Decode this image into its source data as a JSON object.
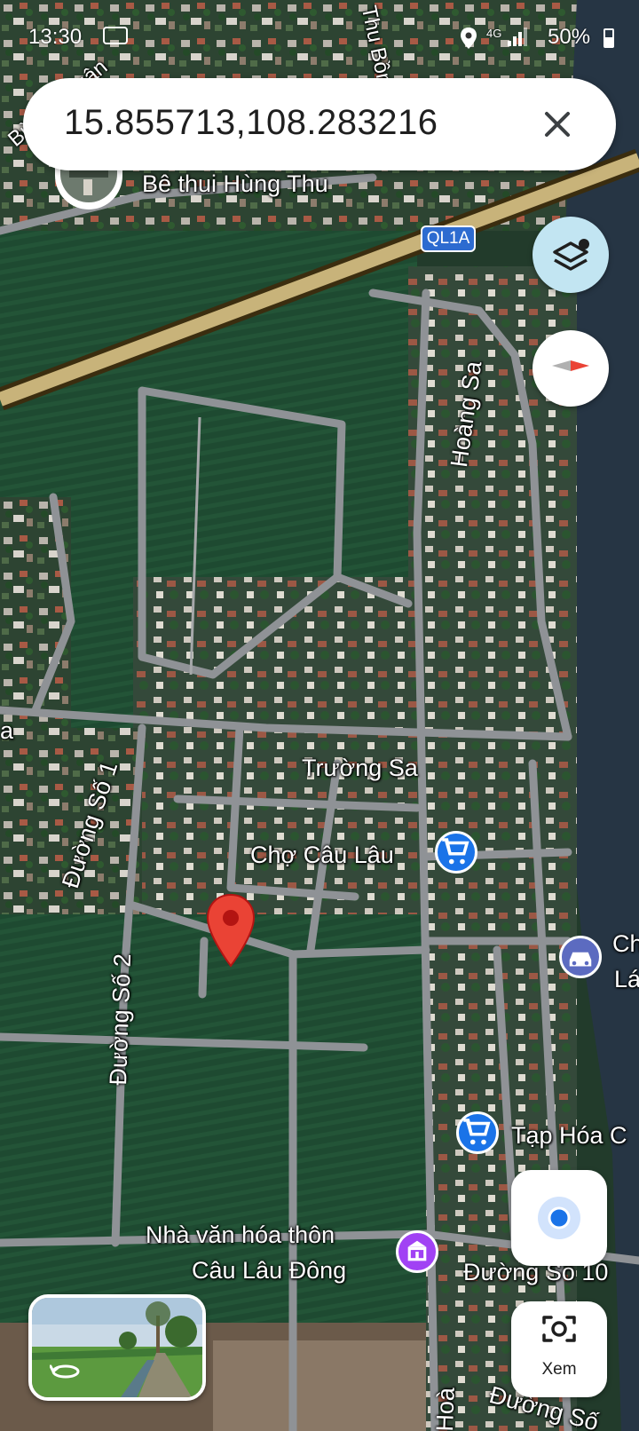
{
  "status_bar": {
    "time": "13:30",
    "battery": "50%",
    "network": "4G"
  },
  "search": {
    "query": "15.855713,108.283216",
    "close_icon": "close-icon"
  },
  "map": {
    "road_badge": "QL1A",
    "labels": {
      "street_bui_thi_xuan": "Bùi Thị Xuân",
      "street_thu_bon": "Thu Bồn",
      "poi_be_thui": "Bê thui Hùng Thu",
      "street_hoang_sa": "Hoàng Sa",
      "street_truong_sa": "Trường Sa",
      "street_duong_so_1": "Đường Số 1",
      "poi_cho_cau_lau": "Chợ Câu Lâu",
      "street_duong_so_2": "Đường Số 2",
      "poi_partial_ch": "Ch",
      "poi_partial_la": "Lá",
      "poi_tap_hoa": "Tạp Hóa C",
      "poi_nha_van_hoa_line1": "Nhà văn hóa thôn",
      "poi_nha_van_hoa_line2": "Câu Lâu Đông",
      "street_duong_so_10": "Đường Số 10",
      "street_ho_partial": "Hoà",
      "street_bottom_partial": "Đường Số",
      "street_left_a": "a"
    },
    "colors": {
      "pin": "#ea4335",
      "shopping": "#1a73e8",
      "car_service": "#5c6bc0",
      "culture": "#a142f4",
      "layers_bg": "#c2e5f2"
    }
  },
  "controls": {
    "lens_label": "Xem"
  }
}
